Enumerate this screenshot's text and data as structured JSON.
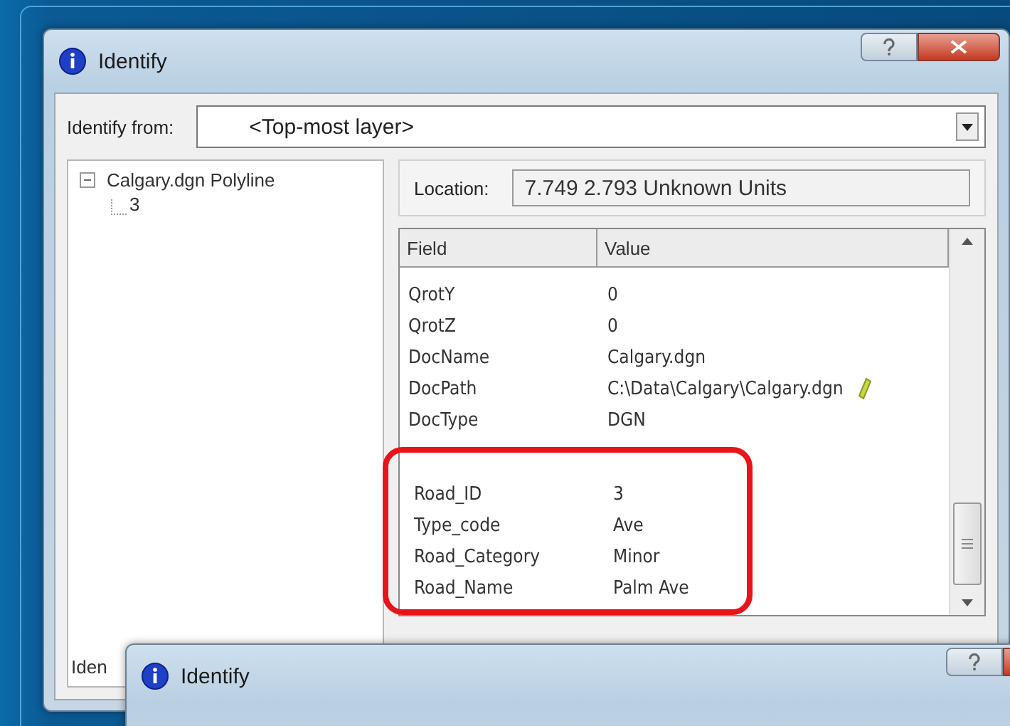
{
  "window": {
    "title": "Identify"
  },
  "identify_from": {
    "label": "Identify from:",
    "value": "<Top-most layer>"
  },
  "tree": [
    {
      "label": "Calgary.dgn Polyline",
      "expanded": true,
      "children": [
        {
          "label": "3"
        }
      ]
    }
  ],
  "location": {
    "label": "Location:",
    "value": "7.749  2.793 Unknown Units"
  },
  "table": {
    "columns": [
      "Field",
      "Value"
    ],
    "rows": [
      {
        "field": "QrotY",
        "value": "0"
      },
      {
        "field": "QrotZ",
        "value": "0"
      },
      {
        "field": "DocName",
        "value": "Calgary.dgn"
      },
      {
        "field": "DocPath",
        "value": "C:\\Data\\Calgary\\Calgary.dgn",
        "editable": true
      },
      {
        "field": "DocType",
        "value": "DGN"
      }
    ],
    "highlighted_rows": [
      {
        "field": "Road_ID",
        "value": "3"
      },
      {
        "field": "Type_code",
        "value": "Ave"
      },
      {
        "field": "Road_Category",
        "value": "Minor"
      },
      {
        "field": "Road_Name",
        "value": "Palm Ave"
      }
    ]
  },
  "status_text": "Iden",
  "second_window": {
    "title": "Identify"
  }
}
